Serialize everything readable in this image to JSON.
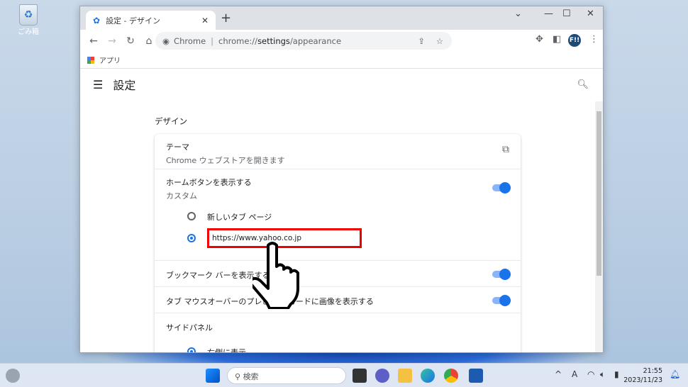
{
  "desktop": {
    "recycle_bin_label": "ごみ箱"
  },
  "browser": {
    "tab_title": "設定 - デザイン",
    "new_tab": "+",
    "omnibox": {
      "site": "Chrome",
      "url_prefix": "chrome://",
      "url_bold": "settings",
      "url_suffix": "/appearance"
    },
    "profile_initials": "F!!",
    "bookmarks": [
      {
        "label": "アプリ"
      }
    ]
  },
  "settings": {
    "title": "設定",
    "section": "デザイン",
    "theme": {
      "label": "テーマ",
      "sub": "Chrome ウェブストアを開きます"
    },
    "home_button": {
      "label": "ホームボタンを表示する",
      "sub": "カスタム",
      "enabled": true,
      "options": [
        {
          "label": "新しいタブ ページ",
          "selected": false
        },
        {
          "value": "https://www.yahoo.co.jp",
          "selected": true
        }
      ]
    },
    "bookmark_bar": {
      "label": "ブックマーク バーを表示する",
      "enabled": true
    },
    "tab_hover": {
      "label": "タブ マウスオーバーのプレビュー カードに画像を表示する",
      "enabled": true
    },
    "side_panel": {
      "label": "サイドパネル",
      "option": "右側に表示"
    }
  },
  "taskbar": {
    "search_placeholder": "検索",
    "time": "21:55",
    "date": "2023/11/23",
    "ime": "A"
  }
}
